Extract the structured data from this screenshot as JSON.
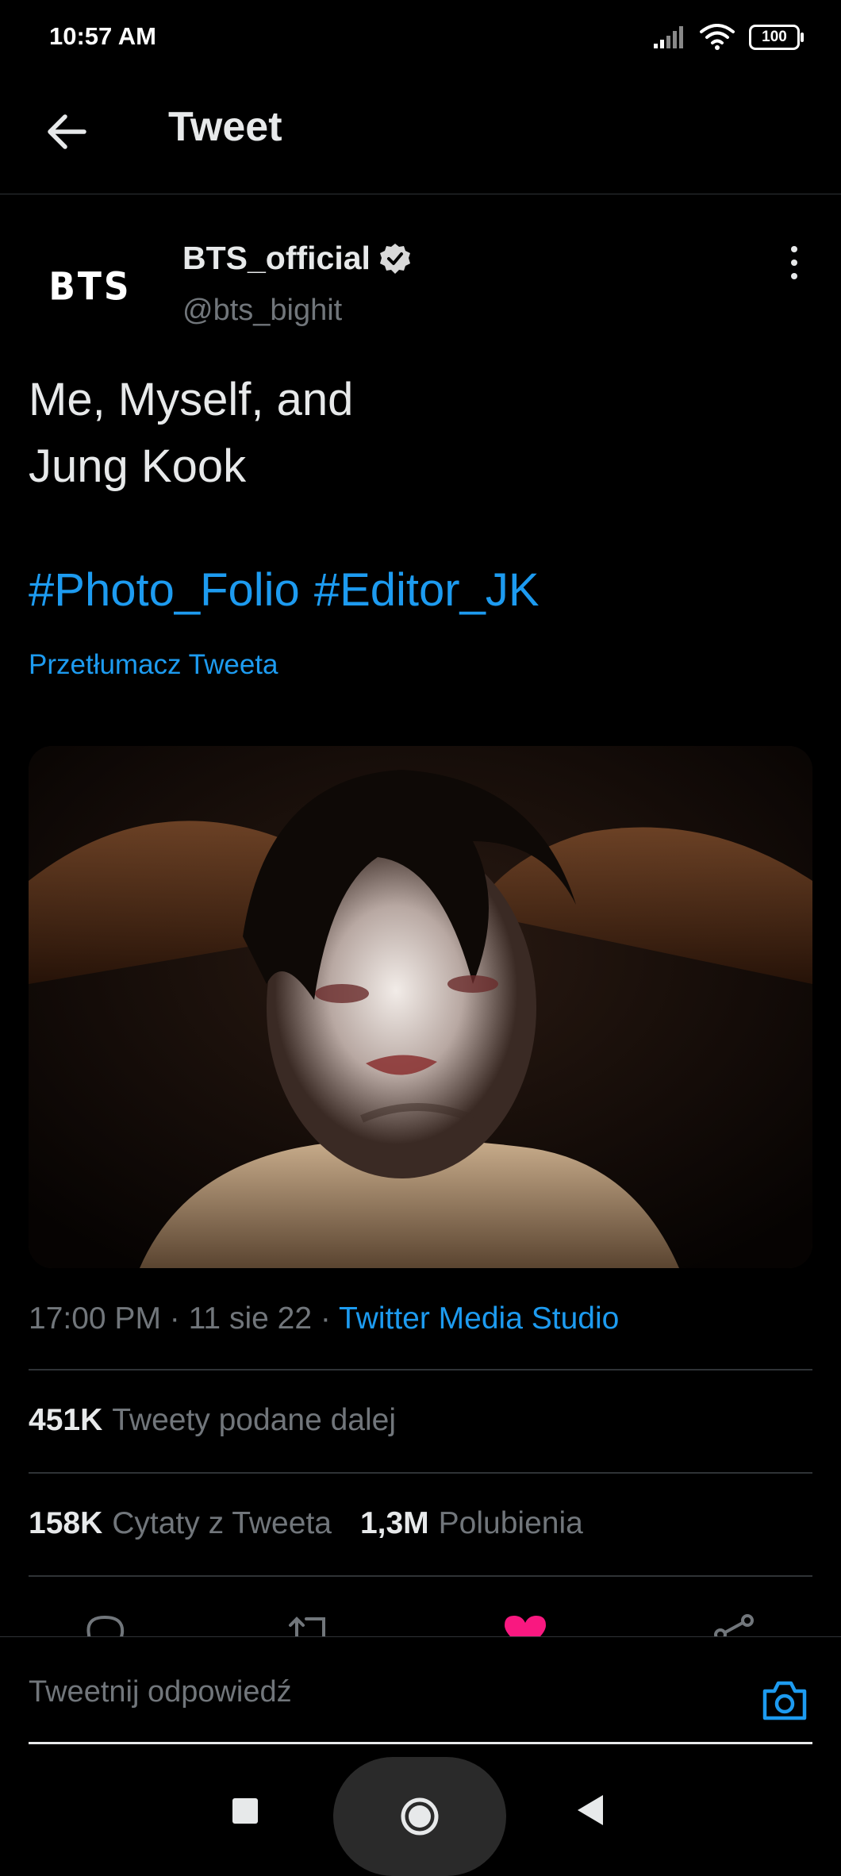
{
  "status_bar": {
    "time": "10:57 AM",
    "battery": "100"
  },
  "header": {
    "title": "Tweet"
  },
  "author": {
    "avatar_text": "BTS",
    "name": "BTS_official",
    "handle": "@bts_bighit",
    "verified": true
  },
  "tweet": {
    "text_line1": "Me, Myself, and",
    "text_line2": "Jung Kook",
    "hashtags": [
      "#Photo_Folio",
      "#Editor_JK"
    ],
    "translate_label": "Przetłumacz Tweeta"
  },
  "meta": {
    "time": "17:00 PM",
    "separator": "·",
    "date": "11 sie 22",
    "source": "Twitter Media Studio"
  },
  "stats": {
    "retweets": {
      "count": "451K",
      "label": "Tweety podane dalej"
    },
    "quotes": {
      "count": "158K",
      "label": "Cytaty z Tweeta"
    },
    "likes": {
      "count": "1,3M",
      "label": "Polubienia"
    }
  },
  "reply": {
    "placeholder": "Tweetnij odpowiedź"
  },
  "colors": {
    "link": "#1d9bf0",
    "like": "#f91880",
    "background": "#000000"
  }
}
